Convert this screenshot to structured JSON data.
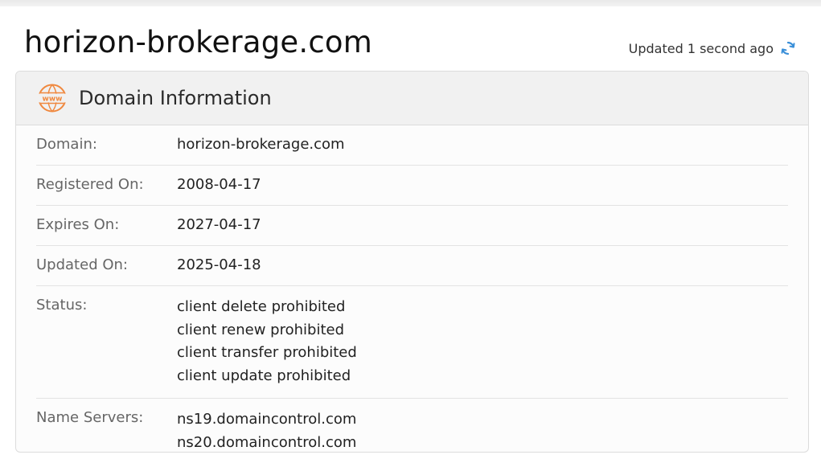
{
  "page": {
    "title": "horizon-brokerage.com",
    "updated_text": "Updated 1 second ago"
  },
  "card": {
    "title": "Domain Information",
    "icon": "www-globe-icon",
    "accent_color": "#f0883e"
  },
  "fields": {
    "domain": {
      "label": "Domain:",
      "values": [
        "horizon-brokerage.com"
      ]
    },
    "registered": {
      "label": "Registered On:",
      "values": [
        "2008-04-17"
      ]
    },
    "expires": {
      "label": "Expires On:",
      "values": [
        "2027-04-17"
      ]
    },
    "updated": {
      "label": "Updated On:",
      "values": [
        "2025-04-18"
      ]
    },
    "status": {
      "label": "Status:",
      "values": [
        "client delete prohibited",
        "client renew prohibited",
        "client transfer prohibited",
        "client update prohibited"
      ]
    },
    "nameservers": {
      "label": "Name Servers:",
      "values": [
        "ns19.domaincontrol.com",
        "ns20.domaincontrol.com"
      ]
    }
  },
  "colors": {
    "refresh_icon": "#3a8fd8",
    "label_text": "#666666",
    "value_text": "#222222"
  }
}
